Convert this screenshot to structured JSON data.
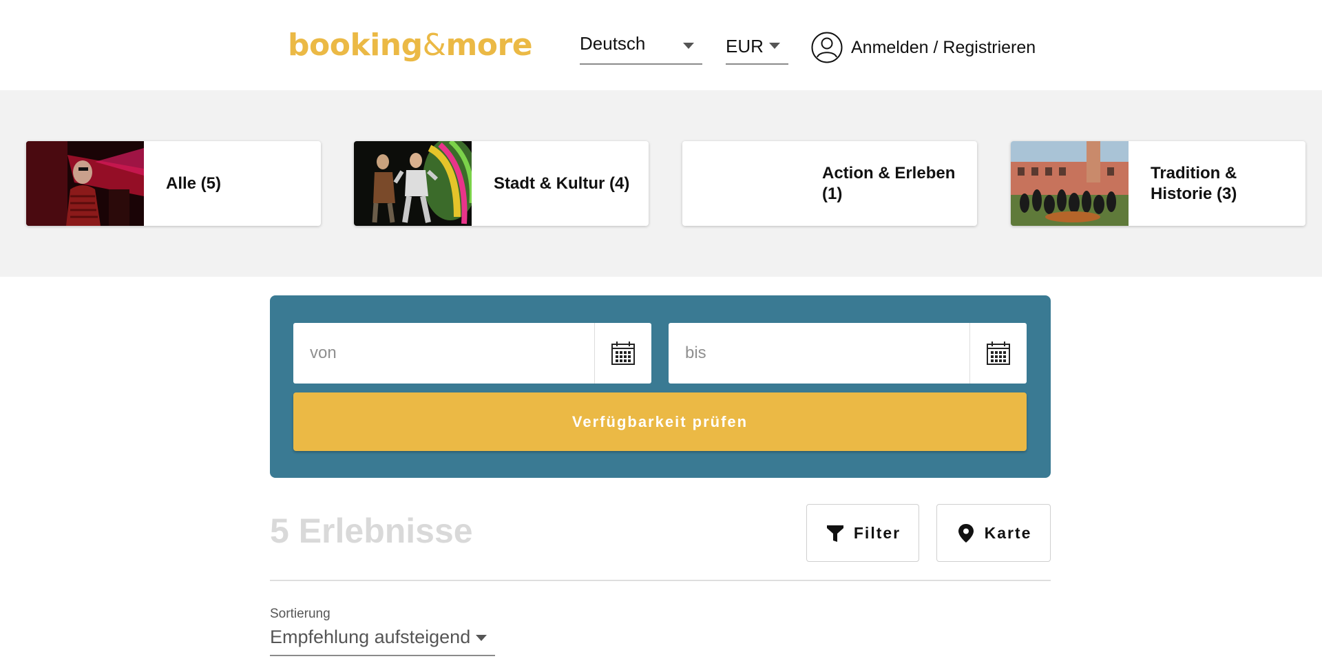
{
  "header": {
    "logo_left": "booking",
    "logo_amp": "&",
    "logo_right": "more",
    "language": "Deutsch",
    "currency": "EUR",
    "login_label": "Anmelden / Registrieren"
  },
  "categories": [
    {
      "label": "Alle (5)",
      "image": "theater-red-stage-photo"
    },
    {
      "label": "Stadt & Kultur (4)",
      "image": "stage-performers-photo"
    },
    {
      "label": "Action & Erleben (1)",
      "image": ""
    },
    {
      "label": "Tradition & Historie (3)",
      "image": "historic-building-group-photo"
    }
  ],
  "search": {
    "from_placeholder": "von",
    "to_placeholder": "bis",
    "check_label": "Verfügbarkeit prüfen"
  },
  "results": {
    "count_label": "5 Erlebnisse",
    "filter_label": "Filter",
    "map_label": "Karte"
  },
  "sort": {
    "label": "Sortierung",
    "value": "Empfehlung aufsteigend"
  },
  "colors": {
    "accent": "#ebb945",
    "panel": "#3a7a93",
    "band": "#f2f2f2"
  }
}
